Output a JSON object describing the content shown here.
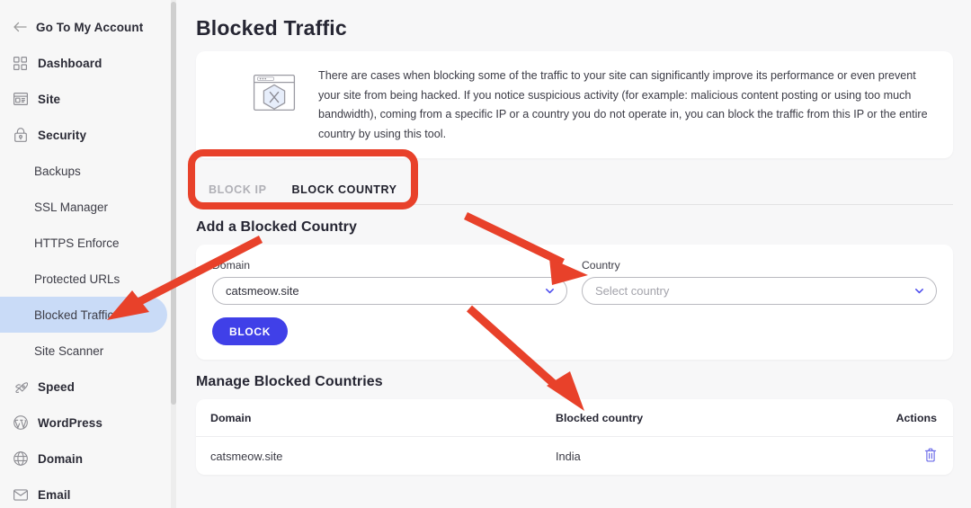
{
  "sidebar": {
    "back": {
      "label": "Go To My Account",
      "icon": "arrow-left-icon"
    },
    "items": [
      {
        "label": "Dashboard",
        "icon": "grid-icon",
        "type": "top",
        "active": false
      },
      {
        "label": "Site",
        "icon": "browser-window-icon",
        "type": "top",
        "active": false
      },
      {
        "label": "Security",
        "icon": "lock-icon",
        "type": "top",
        "active": false
      },
      {
        "label": "Backups",
        "icon": "",
        "type": "sub",
        "active": false
      },
      {
        "label": "SSL Manager",
        "icon": "",
        "type": "sub",
        "active": false
      },
      {
        "label": "HTTPS Enforce",
        "icon": "",
        "type": "sub",
        "active": false
      },
      {
        "label": "Protected URLs",
        "icon": "",
        "type": "sub",
        "active": false
      },
      {
        "label": "Blocked Traffic",
        "icon": "",
        "type": "sub",
        "active": true
      },
      {
        "label": "Site Scanner",
        "icon": "",
        "type": "sub",
        "active": false
      },
      {
        "label": "Speed",
        "icon": "rocket-icon",
        "type": "top",
        "active": false
      },
      {
        "label": "WordPress",
        "icon": "wordpress-icon",
        "type": "top",
        "active": false
      },
      {
        "label": "Domain",
        "icon": "globe-icon",
        "type": "top",
        "active": false
      },
      {
        "label": "Email",
        "icon": "envelope-icon",
        "type": "top",
        "active": false
      }
    ]
  },
  "main": {
    "page_title": "Blocked Traffic",
    "info": {
      "icon": "blocked-site-illustration",
      "text": "There are cases when blocking some of the traffic to your site can significantly improve its performance or even prevent your site from being hacked. If you notice suspicious activity (for example: malicious content posting or using too much bandwidth), coming from a specific IP or a country you do not operate in, you can block the traffic from this IP or the entire country by using this tool."
    },
    "tabs": [
      {
        "label": "BLOCK IP",
        "active": false
      },
      {
        "label": "BLOCK COUNTRY",
        "active": true
      }
    ],
    "add_section": {
      "title": "Add a Blocked Country",
      "domain_label": "Domain",
      "domain_value": "catsmeow.site",
      "country_label": "Country",
      "country_placeholder": "Select country",
      "country_value": "",
      "block_button": "BLOCK"
    },
    "manage_section": {
      "title": "Manage Blocked Countries",
      "columns": [
        "Domain",
        "Blocked country",
        "Actions"
      ],
      "rows": [
        {
          "domain": "catsmeow.site",
          "country": "India",
          "action_icon": "trash-icon"
        }
      ]
    }
  },
  "colors": {
    "accent": "#4040e8",
    "tab_underline": "#4b4bee",
    "active_nav_bg": "#c9dbf7",
    "annotation": "#e8412a",
    "page_bg": "#f7f7f8",
    "card_bg": "#ffffff"
  }
}
